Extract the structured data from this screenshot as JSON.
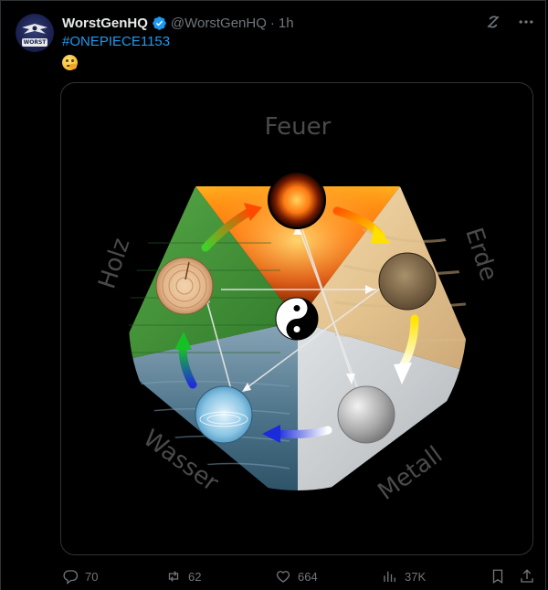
{
  "author": {
    "display_name": "WorstGenHQ",
    "handle": "@WorstGenHQ",
    "separator": "·",
    "time": "1h",
    "avatar_text": "WORST"
  },
  "tweet": {
    "hashtag": "#ONEPIECE1153",
    "emoji_icon": "thinking-face-emoji"
  },
  "image": {
    "labels": {
      "fire": "Feuer",
      "earth": "Erde",
      "metal": "Metall",
      "water": "Wasser",
      "wood": "Holz"
    }
  },
  "actions": {
    "replies": "70",
    "reposts": "62",
    "likes": "664",
    "views": "37K"
  },
  "colors": {
    "background": "#000000",
    "link": "#1d9bf0",
    "muted": "#71767b",
    "verified": "#1d9bf0"
  }
}
